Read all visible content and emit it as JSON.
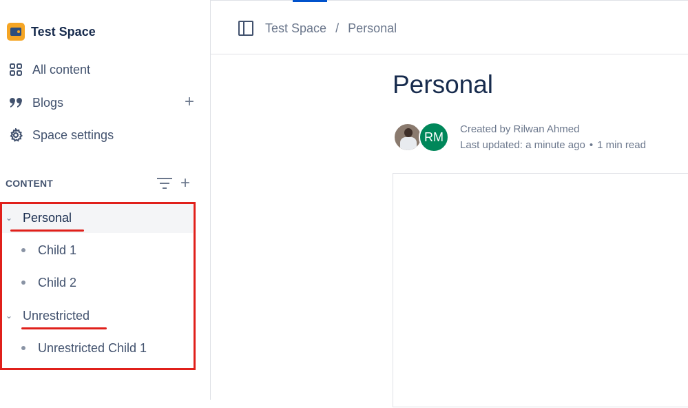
{
  "space": {
    "name": "Test Space"
  },
  "sidebar": {
    "nav": [
      {
        "label": "All content",
        "icon": "grid-icon"
      },
      {
        "label": "Blogs",
        "icon": "quote-icon"
      },
      {
        "label": "Space settings",
        "icon": "gear-icon"
      }
    ],
    "content_heading": "CONTENT",
    "tree": [
      {
        "label": "Personal",
        "expanded": true,
        "children": [
          "Child 1",
          "Child 2"
        ]
      },
      {
        "label": "Unrestricted",
        "expanded": true,
        "children": [
          "Unrestricted Child 1"
        ]
      }
    ]
  },
  "breadcrumb": {
    "space": "Test Space",
    "separator": "/",
    "page": "Personal"
  },
  "page": {
    "title": "Personal",
    "avatar_initials": "RM",
    "created_by": "Created by Rilwan Ahmed",
    "last_updated": "Last updated: a minute ago",
    "meta_dot": "•",
    "read_time": "1 min read"
  },
  "colors": {
    "accent": "#0052cc",
    "annotation_red": "#e0201b",
    "avatar_green": "#00875a"
  }
}
